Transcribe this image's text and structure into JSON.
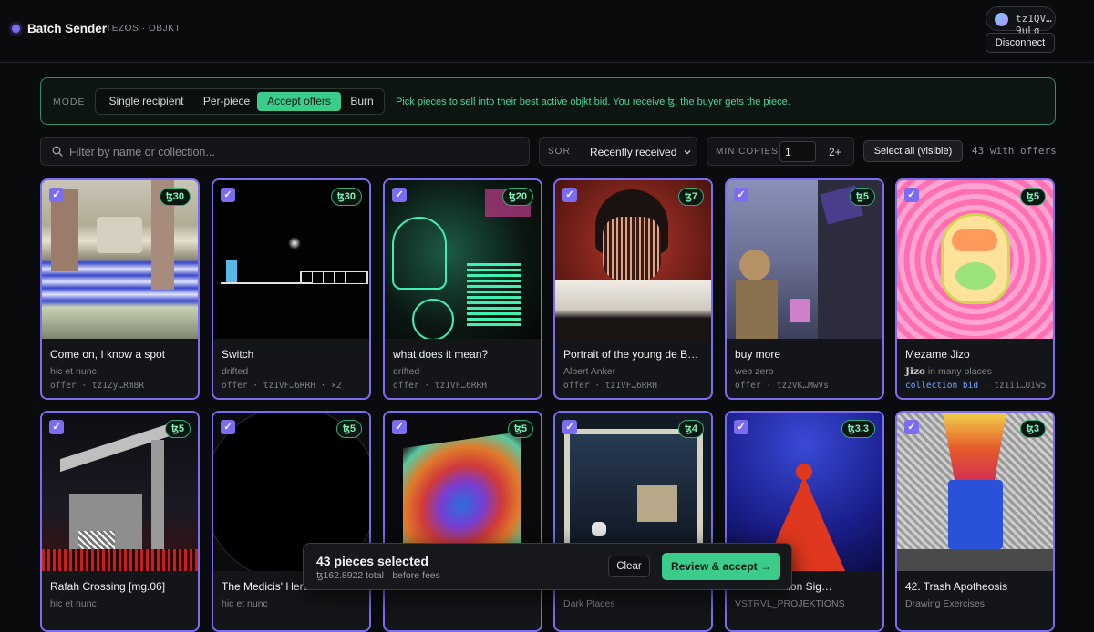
{
  "header": {
    "title": "Batch Sender",
    "subtitle": "TEZOS · OBJKT",
    "wallet_address": "tz1QV…9uLg",
    "disconnect_label": "Disconnect"
  },
  "mode": {
    "label": "MODE",
    "tabs": [
      "Single recipient",
      "Per-piece",
      "Accept offers",
      "Burn"
    ],
    "active_tab": "Accept offers",
    "hint": "Pick pieces to sell into their best active objkt bid. You receive ꜩ; the buyer gets the piece."
  },
  "filters": {
    "search_placeholder": "Filter by name or collection...",
    "sort_label": "SORT",
    "sort_value": "Recently received",
    "min_copies_label": "MIN COPIES",
    "min_copies_value": "1",
    "min_copies_suffix": "2+",
    "select_all_label": "Select all (visible)",
    "offer_count": "43 with offers"
  },
  "cards": [
    {
      "title": "Come on, I know a spot",
      "creator": "hic et nunc",
      "meta": "offer · tz1Zy…Rm8R",
      "price": "ꜩ30",
      "checked": true
    },
    {
      "title": "Switch",
      "creator": "drifted",
      "meta": "offer · tz1VF…6RRH · ×2",
      "price": "ꜩ30",
      "checked": true
    },
    {
      "title": "what does it mean?",
      "creator": "drifted",
      "meta": "offer · tz1VF…6RRH",
      "price": "ꜩ20",
      "checked": true
    },
    {
      "title": "Portrait of the young de B…",
      "creator": "Albert Anker",
      "meta": "offer · tz1VF…6RRH",
      "price": "ꜩ7",
      "checked": true
    },
    {
      "title": "buy more",
      "creator": "web zero",
      "meta": "offer · tz2VK…MwVs",
      "price": "ꜩ5",
      "checked": true
    },
    {
      "title": "Mezame Jizo",
      "creator_name": "Jizo",
      "creator": " in many places",
      "meta_tag": "collection bid",
      "meta": " · tz1i1…Uiw5",
      "price": "ꜩ5",
      "checked": true
    },
    {
      "title": "Rafah Crossing [mg.06]",
      "creator": "hic et nunc",
      "meta": "",
      "price": "ꜩ5",
      "checked": true
    },
    {
      "title": "The Medicis' Hera…",
      "creator": "hic et nunc",
      "meta": "",
      "price": "ꜩ5",
      "checked": true
    },
    {
      "title": "",
      "creator": "",
      "meta": "",
      "price": "ꜩ5",
      "checked": true
    },
    {
      "title": "",
      "creator": "Dark Places",
      "meta": "",
      "price": "ꜩ4",
      "checked": true
    },
    {
      "title": "…Transaction Sig…",
      "creator": "VSTRVL_PROJEKTIONS",
      "meta": "",
      "price": "ꜩ3.3",
      "checked": true
    },
    {
      "title": "42. Trash Apotheosis",
      "creator": "Drawing Exercises",
      "meta": "",
      "price": "ꜩ3",
      "checked": true
    }
  ],
  "selection": {
    "count_label": "43 pieces selected",
    "total_label": "ꜩ162.8922 total · before fees",
    "clear_label": "Clear",
    "review_label": "Review & accept →"
  },
  "colors": {
    "accent_purple": "#7c6cf0",
    "accent_green": "#3bcc8b",
    "background": "#0a0b0d"
  }
}
